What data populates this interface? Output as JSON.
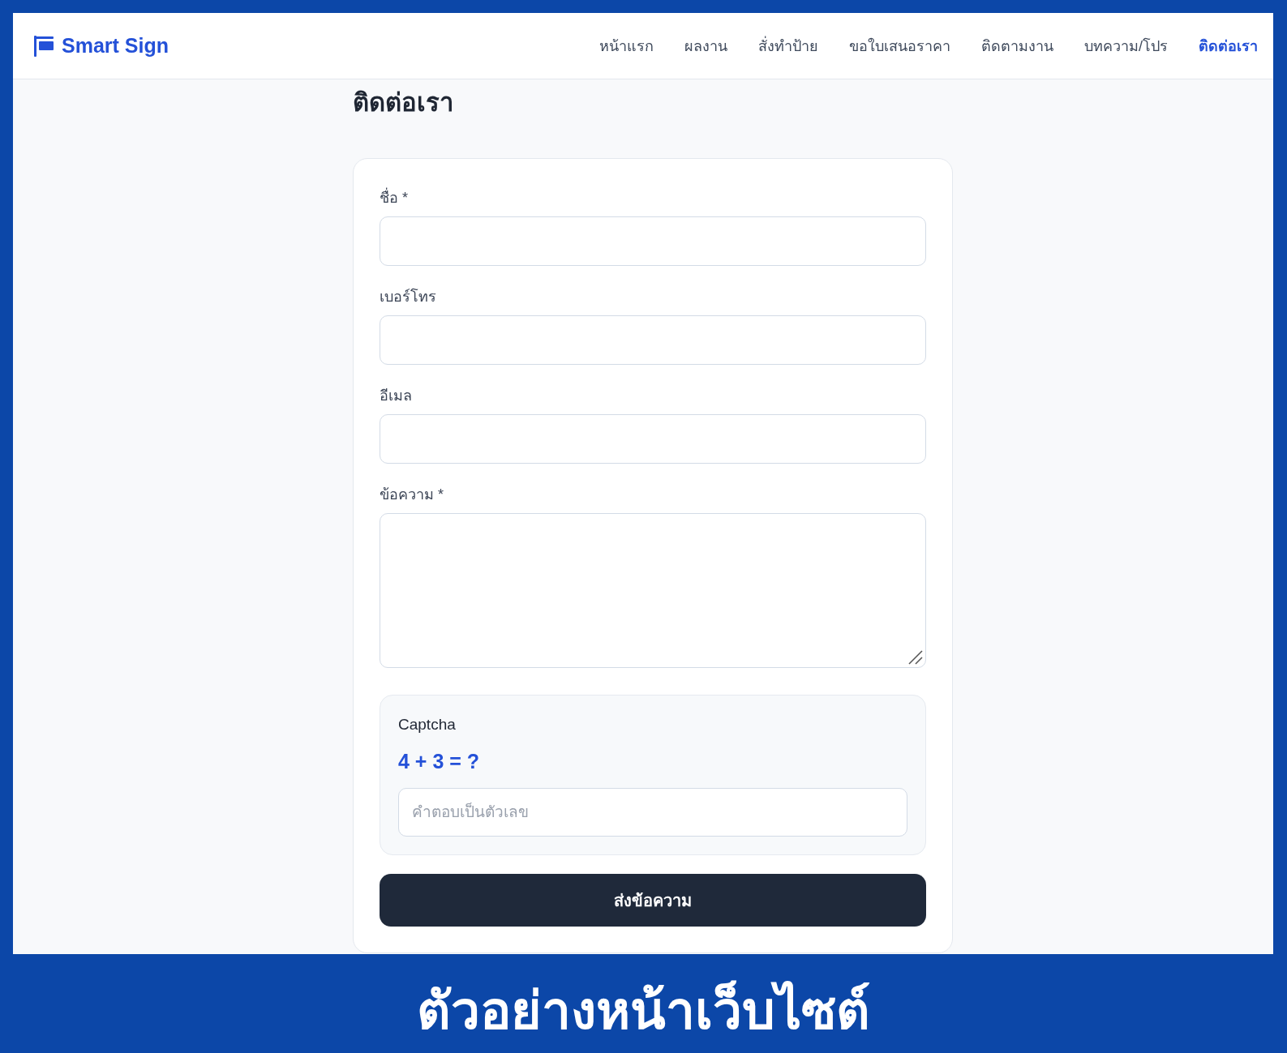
{
  "site": {
    "logo": "Smart Sign"
  },
  "nav": [
    {
      "label": "หน้าแรก",
      "selected": false
    },
    {
      "label": "ผลงาน",
      "selected": false
    },
    {
      "label": "สั่งทำป้าย",
      "selected": false
    },
    {
      "label": "ขอใบเสนอราคา",
      "selected": false
    },
    {
      "label": "ติดตามงาน",
      "selected": false
    },
    {
      "label": "บทความ/โปร",
      "selected": false
    },
    {
      "label": "ติดต่อเรา",
      "selected": true
    }
  ],
  "page_title": "ติดต่อเรา",
  "form": {
    "fields": [
      {
        "kind": "input",
        "label": "ชื่อ *"
      },
      {
        "kind": "input",
        "label": "เบอร์โทร"
      },
      {
        "kind": "input",
        "label": "อีเมล"
      },
      {
        "kind": "textarea",
        "label": "ข้อความ *"
      }
    ],
    "captcha": {
      "title": "Captcha",
      "question": "4 + 3 = ?",
      "placeholder": "คำตอบเป็นตัวเลข"
    },
    "submit": "ส่งข้อความ"
  },
  "banner": "ตัวอย่างหน้าเว็บไซต์"
}
